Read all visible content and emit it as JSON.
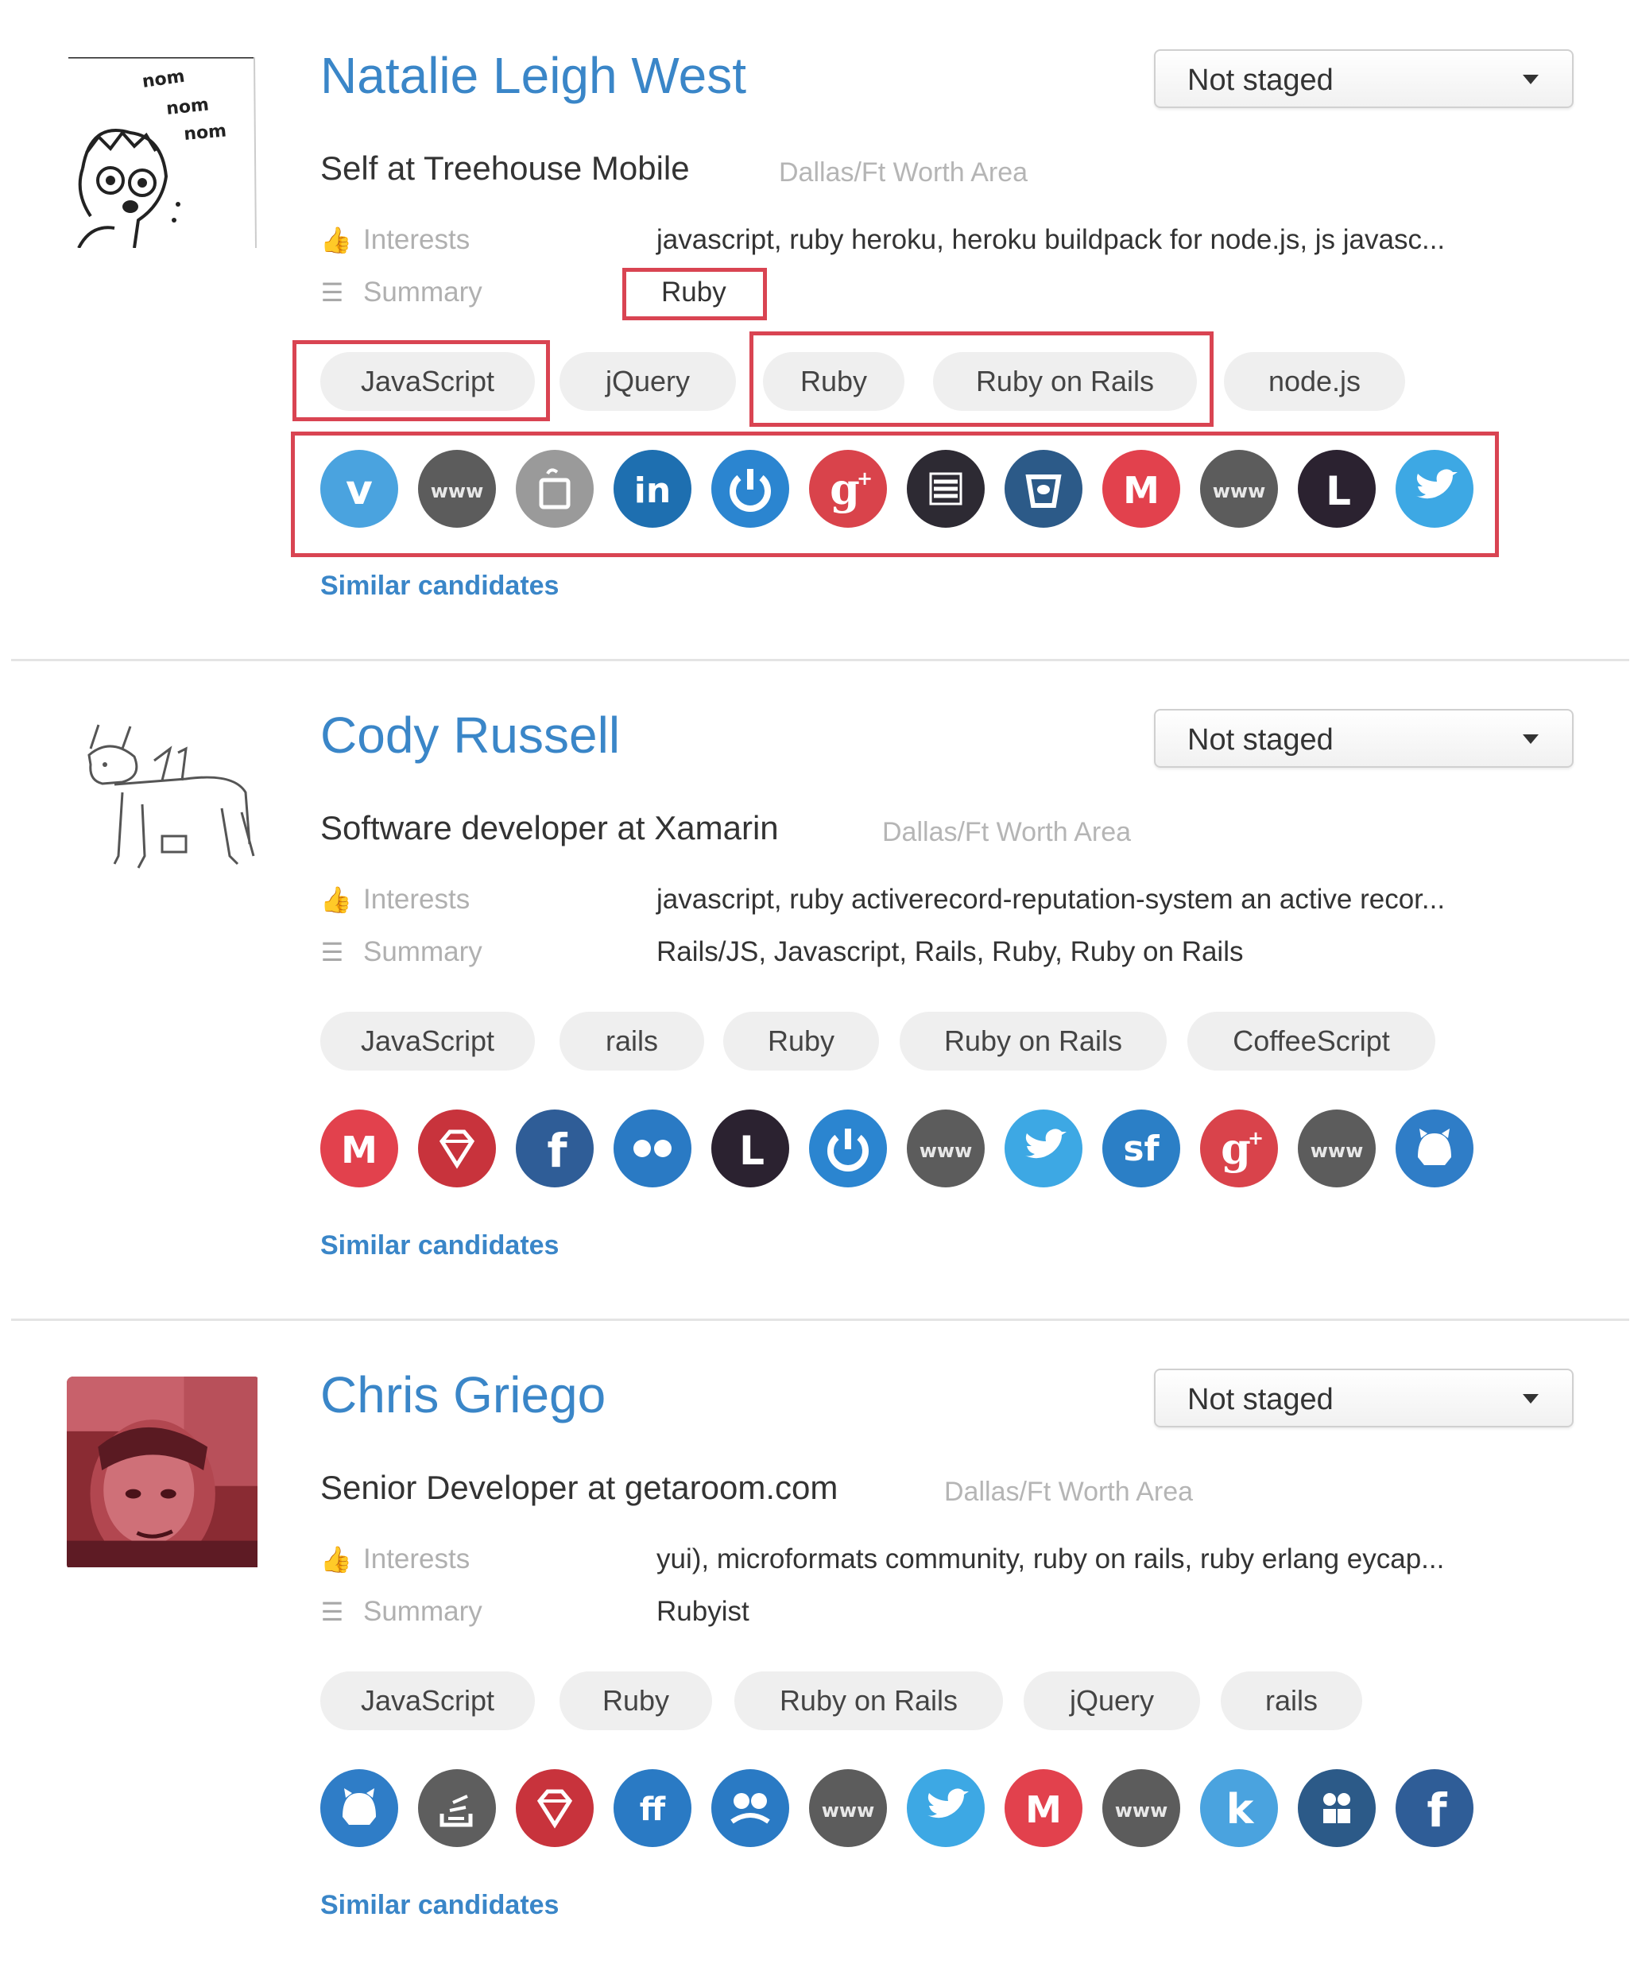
{
  "status_default": "Not staged",
  "labels": {
    "interests": "Interests",
    "summary": "Summary",
    "similar": "Similar candidates"
  },
  "colors": {
    "link": "#3a86c8",
    "highlight": "#d94452",
    "tag_bg": "#efefef",
    "muted": "#b5b5b5"
  },
  "candidates": [
    {
      "name": "Natalie Leigh West",
      "headline": "Self at Treehouse Mobile",
      "location": "Dallas/Ft Worth Area",
      "status": "Not staged",
      "interests": "javascript, ruby heroku, heroku buildpack for node.js, js javasc...",
      "summary": "Ruby",
      "avatar_text": [
        "nom",
        "nom",
        "nom"
      ],
      "tags": [
        "JavaScript",
        "jQuery",
        "Ruby",
        "Ruby on Rails",
        "node.js"
      ],
      "socials": [
        {
          "icon": "vimeo-icon",
          "glyph": "v",
          "color": "#4aa3df"
        },
        {
          "icon": "website-icon",
          "glyph": "www",
          "color": "#5c5c5c"
        },
        {
          "icon": "cup-icon",
          "glyph": "cup",
          "color": "#9a9a9a"
        },
        {
          "icon": "linkedin-icon",
          "glyph": "in",
          "color": "#1e6fb0"
        },
        {
          "icon": "power-icon",
          "glyph": "pwr",
          "color": "#2b85d0"
        },
        {
          "icon": "google-plus-icon",
          "glyph": "g+",
          "color": "#d9434b"
        },
        {
          "icon": "list-icon",
          "glyph": "list",
          "color": "#2d2a33"
        },
        {
          "icon": "bucket-icon",
          "glyph": "bkt",
          "color": "#2c5a88"
        },
        {
          "icon": "meetup-icon",
          "glyph": "M",
          "color": "#e2414d"
        },
        {
          "icon": "website-icon",
          "glyph": "www",
          "color": "#5c5c5c"
        },
        {
          "icon": "letter-l-icon",
          "glyph": "L",
          "color": "#2b2230"
        },
        {
          "icon": "twitter-icon",
          "glyph": "tw",
          "color": "#3da8e4"
        }
      ]
    },
    {
      "name": "Cody Russell",
      "headline": "Software developer at Xamarin",
      "location": "Dallas/Ft Worth Area",
      "status": "Not staged",
      "interests": "javascript, ruby activerecord-reputation-system an active recor...",
      "summary": "Rails/JS, Javascript, Rails, Ruby, Ruby on Rails",
      "tags": [
        "JavaScript",
        "rails",
        "Ruby",
        "Ruby on Rails",
        "CoffeeScript"
      ],
      "socials": [
        {
          "icon": "meetup-icon",
          "glyph": "M",
          "color": "#e2414d"
        },
        {
          "icon": "gem-icon",
          "glyph": "gem",
          "color": "#c8333c"
        },
        {
          "icon": "facebook-icon",
          "glyph": "f",
          "color": "#2f5d97"
        },
        {
          "icon": "flickr-icon",
          "glyph": "flk",
          "color": "#2a7ac4"
        },
        {
          "icon": "letter-l-icon",
          "glyph": "L",
          "color": "#2b2230"
        },
        {
          "icon": "power-icon",
          "glyph": "pwr",
          "color": "#2b85d0"
        },
        {
          "icon": "website-icon",
          "glyph": "www",
          "color": "#5c5c5c"
        },
        {
          "icon": "twitter-icon",
          "glyph": "tw",
          "color": "#3da8e4"
        },
        {
          "icon": "stackflow-icon",
          "glyph": "sf",
          "color": "#2b7fc6"
        },
        {
          "icon": "google-plus-icon",
          "glyph": "g+",
          "color": "#d9434b"
        },
        {
          "icon": "website-icon",
          "glyph": "www",
          "color": "#5c5c5c"
        },
        {
          "icon": "github-icon",
          "glyph": "gh",
          "color": "#2f7dc7"
        }
      ]
    },
    {
      "name": "Chris Griego",
      "headline": "Senior Developer at getaroom.com",
      "location": "Dallas/Ft Worth Area",
      "status": "Not staged",
      "interests": "yui), microformats community, ruby on rails, ruby erlang eycap...",
      "summary": "Rubyist",
      "tags": [
        "JavaScript",
        "Ruby",
        "Ruby on Rails",
        "jQuery",
        "rails"
      ],
      "socials": [
        {
          "icon": "github-icon",
          "glyph": "gh",
          "color": "#2f7dc7"
        },
        {
          "icon": "stackoverflow-icon",
          "glyph": "so",
          "color": "#5e5e5e"
        },
        {
          "icon": "gem-icon",
          "glyph": "gem",
          "color": "#c8333c"
        },
        {
          "icon": "friendfeed-icon",
          "glyph": "ff",
          "color": "#2a7ac4"
        },
        {
          "icon": "people-icon",
          "glyph": "ppl",
          "color": "#2a7ac4"
        },
        {
          "icon": "website-icon",
          "glyph": "www",
          "color": "#5c5c5c"
        },
        {
          "icon": "twitter-icon",
          "glyph": "tw",
          "color": "#3da8e4"
        },
        {
          "icon": "meetup-icon",
          "glyph": "M",
          "color": "#e2414d"
        },
        {
          "icon": "website-icon",
          "glyph": "www",
          "color": "#5c5c5c"
        },
        {
          "icon": "klout-icon",
          "glyph": "k",
          "color": "#4aa3df"
        },
        {
          "icon": "team-icon",
          "glyph": "tm",
          "color": "#2c5a88"
        },
        {
          "icon": "facebook-icon",
          "glyph": "f",
          "color": "#2f5d97"
        }
      ]
    }
  ]
}
